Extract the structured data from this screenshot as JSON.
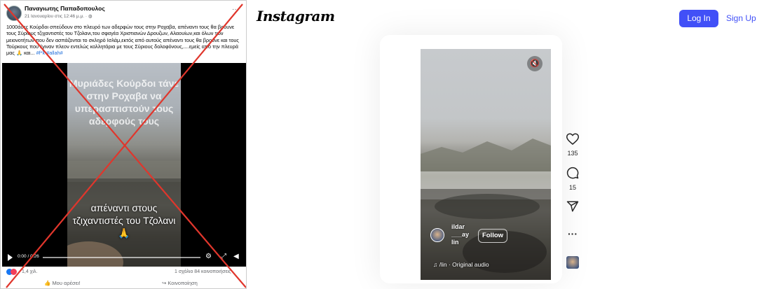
{
  "facebook": {
    "author": "Παναγιωτης Παπαδοπουλος",
    "date": "21 Ιανουαρίου στις 12:46 μ.μ. · ",
    "post_text": "1000άδες Κούρδοι σπεύδουν στο πλευρό των αδερφών τους στην Ροχαβα, απέναντι τους θα βρουνε τους Σύριους τζιχαντιστές του Τζολανι,του σφαγέα Χριστιανών Δρουζων, Αλαουίων,και όλων των μειονοτήτων που δεν ασπάζονται το σκληρό Ισλάμ,εκτός από αυτούς απέναντι τους θα βρούνε και τους Τούρκους που έγιναν πλεον εντελώς κολλητάρια με τους Σύριους δολοφόνους,....εμείς από την πλευρά μας 🙏 και...",
    "hashtags": "#f*k #allah#",
    "video_overlay_top": "Μυριάδες Κούρδοι τάνε στην Ροχαβα να υπερασπιστούν τους αδερφούς τους",
    "video_overlay_bottom": "απέναντι στους τζιχαντιστές του Τζολανι 🙏",
    "video_time": "0:00 / 0:26",
    "reaction_count": "1,4 χιλ.",
    "comments_shares": "1 σχόλιο  84 κοινοποιήσεις",
    "like_label": "Μου αρέσει!",
    "share_label": "Κοινοποίηση",
    "overlay_color": "#e0362c"
  },
  "instagram": {
    "logo": "Instagram",
    "login_label": "Log In",
    "signup_label": "Sign Up",
    "accent": "#4150f7",
    "username": "ildar\n___ay\nlin",
    "follow_label": "Follow",
    "audio_label": "♫  /lin · Original audio",
    "likes": "135",
    "comments": "15",
    "icons": [
      "heart-icon",
      "comment-icon",
      "share-icon",
      "more-icon",
      "mute-icon"
    ]
  }
}
